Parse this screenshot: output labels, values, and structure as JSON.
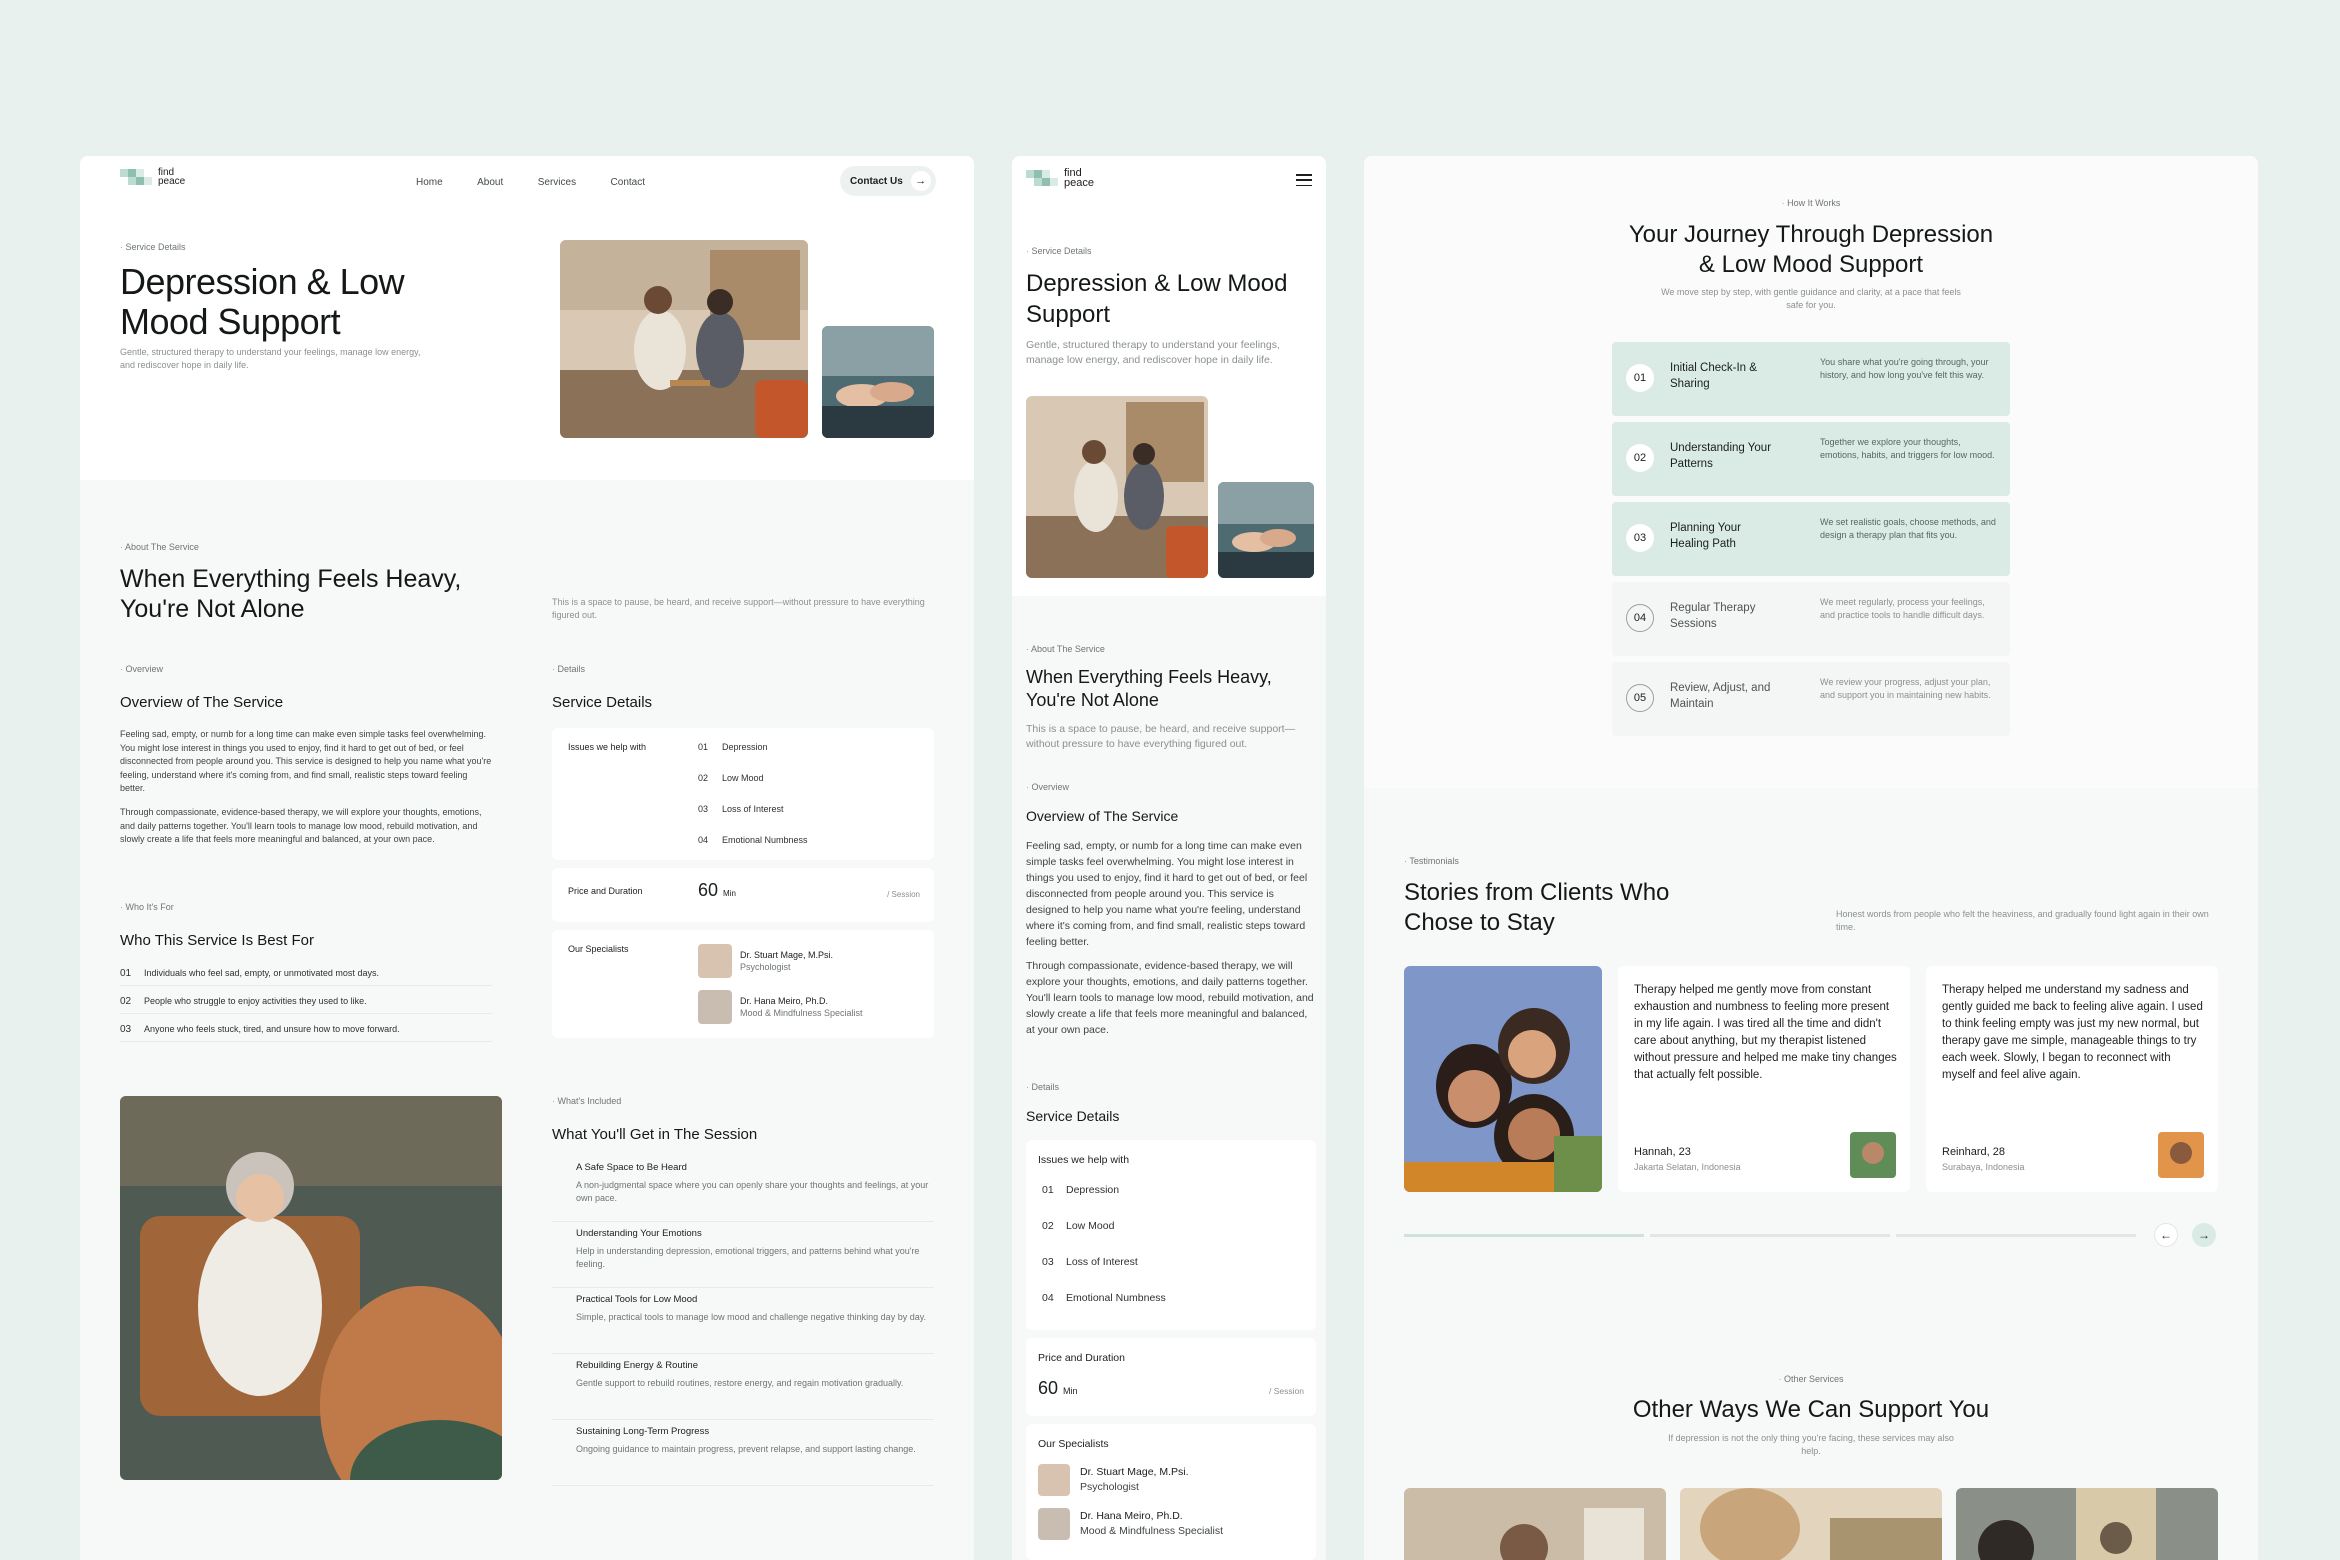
{
  "brand": {
    "name_line1": "find",
    "name_line2": "peace"
  },
  "nav": {
    "home": "Home",
    "about": "About",
    "services": "Services",
    "contact": "Contact",
    "cta": "Contact Us"
  },
  "hero": {
    "tag": "Service Details",
    "title_line1": "Depression & Low",
    "title_line2": "Mood Support",
    "mobile_title_line1": "Depression & Low Mood",
    "mobile_title_line2": "Support",
    "subtitle": "Gentle, structured therapy to understand your feelings, manage low energy, and rediscover hope in daily life."
  },
  "about": {
    "tag": "About The Service",
    "title_line1": "When Everything Feels Heavy,",
    "title_line2": "You're Not Alone",
    "desc": "This is a space to pause, be heard, and receive support—without pressure to have everything figured out."
  },
  "overview": {
    "tag": "Overview",
    "title": "Overview of The Service",
    "p1": "Feeling sad, empty, or numb for a long time can make even simple tasks feel overwhelming. You might lose interest in things you used to enjoy, find it hard to get out of bed, or feel disconnected from people around you. This service is designed to help you name what you're feeling, understand where it's coming from, and find small, realistic steps toward feeling better.",
    "p2": "Through compassionate, evidence-based therapy, we will explore your thoughts, emotions, and daily patterns together. You'll learn tools to manage low mood, rebuild motivation, and slowly create a life that feels more meaningful and balanced, at your own pace."
  },
  "details": {
    "tag": "Details",
    "title": "Service Details",
    "issues_label": "Issues we help with",
    "issues": [
      {
        "n": "01",
        "label": "Depression"
      },
      {
        "n": "02",
        "label": "Low Mood"
      },
      {
        "n": "03",
        "label": "Loss of Interest"
      },
      {
        "n": "04",
        "label": "Emotional Numbness"
      }
    ],
    "price_label": "Price and Duration",
    "price_value": "60",
    "price_unit": "Min",
    "price_per": "/ Session",
    "specialists_label": "Our Specialists",
    "specialists": [
      {
        "name": "Dr. Stuart Mage, M.Psi.",
        "role": "Psychologist"
      },
      {
        "name": "Dr. Hana Meiro, Ph.D.",
        "role": "Mood & Mindfulness Specialist"
      }
    ]
  },
  "who": {
    "tag": "Who It's For",
    "title": "Who This Service Is Best For",
    "items": [
      {
        "n": "01",
        "label": "Individuals who feel sad, empty, or unmotivated most days."
      },
      {
        "n": "02",
        "label": "People who struggle to enjoy activities they used to like."
      },
      {
        "n": "03",
        "label": "Anyone who feels stuck, tired, and unsure how to move forward."
      }
    ]
  },
  "included": {
    "tag": "What's Included",
    "title": "What You'll Get in The Session",
    "items": [
      {
        "t": "A Safe Space to Be Heard",
        "d": "A non-judgmental space where you can openly share your thoughts and feelings, at your own pace."
      },
      {
        "t": "Understanding Your Emotions",
        "d": "Help in understanding depression, emotional triggers, and patterns behind what you're feeling."
      },
      {
        "t": "Practical Tools for Low Mood",
        "d": "Simple, practical tools to manage low mood and challenge negative thinking day by day."
      },
      {
        "t": "Rebuilding Energy & Routine",
        "d": "Gentle support to rebuild routines, restore energy, and regain motivation gradually."
      },
      {
        "t": "Sustaining Long-Term Progress",
        "d": "Ongoing guidance to maintain progress, prevent relapse, and support lasting change."
      }
    ]
  },
  "journey": {
    "tag": "How It Works",
    "title_line1": "Your Journey Through Depression",
    "title_line2": "& Low Mood Support",
    "subtitle": "We move step by step, with gentle guidance and clarity, at a pace that feels safe for you.",
    "steps": [
      {
        "n": "01",
        "t": "Initial Check-In & Sharing",
        "d": "You share what you're going through, your history, and how long you've felt this way."
      },
      {
        "n": "02",
        "t": "Understanding Your Patterns",
        "d": "Together we explore your thoughts, emotions, habits, and triggers for low mood."
      },
      {
        "n": "03",
        "t": "Planning Your Healing Path",
        "d": "We set realistic goals, choose methods, and design a therapy plan that fits you."
      },
      {
        "n": "04",
        "t": "Regular Therapy Sessions",
        "d": "We meet regularly, process your feelings, and practice tools to handle difficult days."
      },
      {
        "n": "05",
        "t": "Review, Adjust, and Maintain",
        "d": "We review your progress, adjust your plan, and support you in maintaining new habits."
      }
    ]
  },
  "testimonials": {
    "tag": "Testimonials",
    "title_line1": "Stories from Clients Who",
    "title_line2": "Chose to Stay",
    "subtitle": "Honest words from people who felt the heaviness, and gradually found light again in their own time.",
    "items": [
      {
        "quote": "Therapy helped me gently move from constant exhaustion and numbness to feeling more present in my life again. I was tired all the time and didn't care about anything, but my therapist listened without pressure and helped me make tiny changes that actually felt possible.",
        "name": "Hannah, 23",
        "loc": "Jakarta Selatan, Indonesia"
      },
      {
        "quote": "Therapy helped me understand my sadness and gently guided me back to feeling alive again. I used to think feeling empty was just my new normal, but therapy gave me simple, manageable things to try each week. Slowly, I began to reconnect with myself and feel alive again.",
        "name": "Reinhard, 28",
        "loc": "Surabaya, Indonesia"
      }
    ],
    "prev": "←",
    "next": "→"
  },
  "other": {
    "tag": "Other Services",
    "title": "Other Ways We Can Support You",
    "subtitle": "If depression is not the only thing you're facing, these services may also help."
  },
  "icons": {
    "arrow": "→",
    "menu": "menu-icon"
  },
  "colors": {
    "mint": "#d9ebe4",
    "mint_dark": "#bcdcd0",
    "bg": "#e9f1ee"
  }
}
